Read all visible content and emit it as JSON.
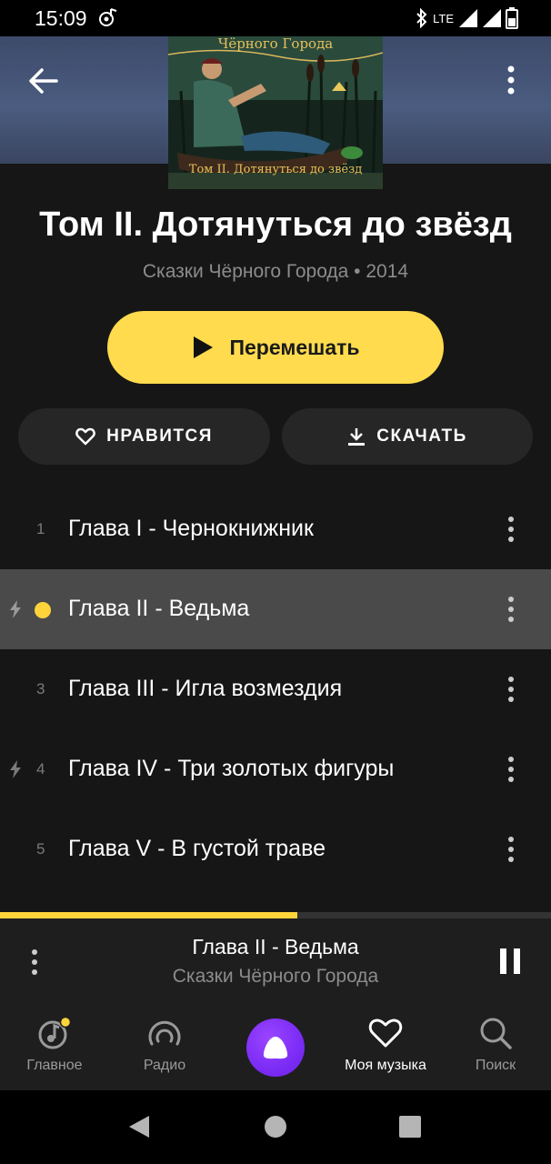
{
  "status_bar": {
    "time": "15:09",
    "network": "LTE"
  },
  "header": {
    "back_icon": "arrow-left-icon",
    "more_icon": "more-vertical-icon",
    "cover_art": {
      "top_text": "Чёрного Города",
      "bottom_text": "Том II. Дотянуться до звёзд"
    }
  },
  "album": {
    "title": "Том II. Дотянуться до звёзд",
    "subtitle": "Сказки Чёрного Города • 2014"
  },
  "actions": {
    "shuffle_label": "Перемешать",
    "like_label": "НРАВИТСЯ",
    "download_label": "СКАЧАТЬ"
  },
  "tracks": [
    {
      "number": "1",
      "title": "Глава I - Чернокнижник",
      "playing": false,
      "bolt": false
    },
    {
      "number": "2",
      "title": "Глава II - Ведьма",
      "playing": true,
      "bolt": true
    },
    {
      "number": "3",
      "title": "Глава III - Игла возмездия",
      "playing": false,
      "bolt": false
    },
    {
      "number": "4",
      "title": "Глава IV - Три золотых фигуры",
      "playing": false,
      "bolt": true
    },
    {
      "number": "5",
      "title": "Глава V - В густой траве",
      "playing": false,
      "bolt": false
    }
  ],
  "player": {
    "title": "Глава II - Ведьма",
    "artist": "Сказки Чёрного Города",
    "progress": 0.54
  },
  "bottom_nav": [
    {
      "label": "Главное",
      "icon": "music-note-icon"
    },
    {
      "label": "Радио",
      "icon": "radio-icon"
    },
    {
      "label": "",
      "icon": "alice-assistant-icon"
    },
    {
      "label": "Моя музыка",
      "icon": "heart-icon",
      "active": true
    },
    {
      "label": "Поиск",
      "icon": "search-icon"
    }
  ],
  "colors": {
    "accent": "#ffdb4d",
    "background": "#161616",
    "active_row": "#4a4a4a",
    "alice": "#7b2cf5"
  }
}
